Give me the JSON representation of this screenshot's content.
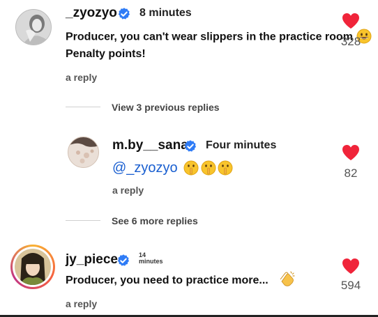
{
  "comments": [
    {
      "username": "_zyozyo",
      "time": "8 minutes",
      "text_line1": "Producer, you can't wear slippers in the practice room",
      "text_line2": "Penalty points!",
      "reply_label": "a reply",
      "likes": "328"
    },
    {
      "username": "m.by__sana",
      "time": "Four minutes",
      "mention": "@_zyozyo",
      "reply_label": "a reply",
      "likes": "82"
    },
    {
      "username": "jy_piece",
      "time_line1": "14",
      "time_line2": "minutes",
      "text": "Producer, you need to practice more...",
      "reply_label": "a reply",
      "likes": "594"
    }
  ],
  "threads": {
    "view_previous": "View 3 previous replies",
    "see_more": "See 6 more replies"
  },
  "colors": {
    "heart": "#f0243a",
    "verified": "#2f7cf6",
    "mention": "#1a5fd0",
    "story_ring_start": "#f9b233",
    "story_ring_end": "#c13584"
  },
  "icons": {
    "verified": "verified-badge-icon",
    "like": "heart-icon",
    "emoji_smile": "grinning-face-emoji",
    "emoji_shush": "shushing-face-emoji",
    "emoji_clap": "clapping-hands-emoji"
  }
}
